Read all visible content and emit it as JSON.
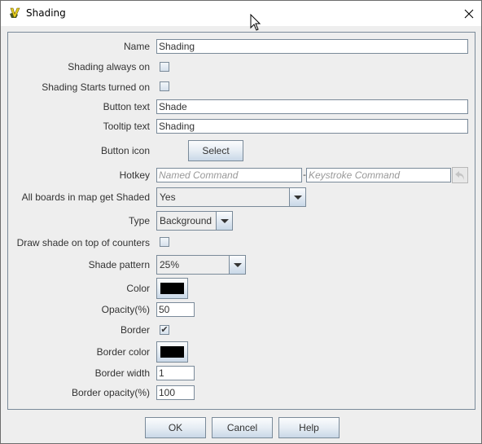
{
  "window": {
    "title": "Shading",
    "app_icon": "vassal-logo-icon",
    "close_icon": "close-icon"
  },
  "form": {
    "name": {
      "label": "Name",
      "value": "Shading"
    },
    "always_on": {
      "label": "Shading always on",
      "checked": false
    },
    "starts_on": {
      "label": "Shading Starts turned on",
      "checked": false
    },
    "button_text": {
      "label": "Button text",
      "value": "Shade"
    },
    "tooltip_text": {
      "label": "Tooltip text",
      "value": "Shading"
    },
    "button_icon": {
      "label": "Button icon",
      "button": "Select"
    },
    "hotkey": {
      "label": "Hotkey",
      "named_placeholder": "Named Command",
      "separator": "-",
      "keystroke_placeholder": "Keystroke Command",
      "undo_icon": "undo-arrow-icon"
    },
    "all_boards": {
      "label": "All boards in map get Shaded",
      "value": "Yes"
    },
    "type": {
      "label": "Type",
      "value": "Background"
    },
    "draw_on_top": {
      "label": "Draw shade on top of counters",
      "checked": false
    },
    "shade_pattern": {
      "label": "Shade pattern",
      "value": "25%"
    },
    "color": {
      "label": "Color",
      "value": "#000000"
    },
    "opacity": {
      "label": "Opacity(%)",
      "value": "50"
    },
    "border": {
      "label": "Border",
      "checked": true,
      "check_glyph": "✔"
    },
    "border_color": {
      "label": "Border color",
      "value": "#000000"
    },
    "border_width": {
      "label": "Border width",
      "value": "1"
    },
    "border_opacity": {
      "label": "Border opacity(%)",
      "value": "100"
    }
  },
  "buttons": {
    "ok": "OK",
    "cancel": "Cancel",
    "help": "Help"
  }
}
